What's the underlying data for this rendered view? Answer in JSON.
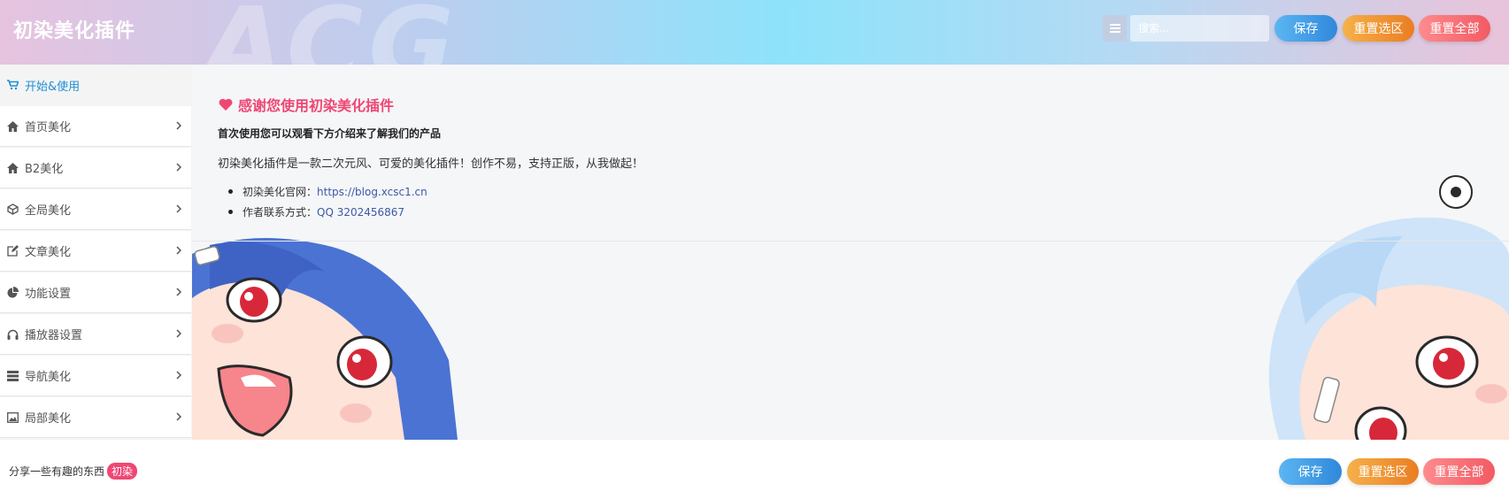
{
  "header": {
    "title": "初染美化插件",
    "search_placeholder": "搜索...",
    "buttons": {
      "save": "保存",
      "reset_section": "重置选区",
      "reset_all": "重置全部"
    }
  },
  "sidebar": {
    "items": [
      {
        "label": "开始&使用",
        "icon": "cart-icon",
        "active": true
      },
      {
        "label": "首页美化",
        "icon": "home-icon"
      },
      {
        "label": "B2美化",
        "icon": "home-icon"
      },
      {
        "label": "全局美化",
        "icon": "cube-icon"
      },
      {
        "label": "文章美化",
        "icon": "edit-icon"
      },
      {
        "label": "功能设置",
        "icon": "pie-chart-icon"
      },
      {
        "label": "播放器设置",
        "icon": "headphones-icon"
      },
      {
        "label": "导航美化",
        "icon": "server-icon"
      },
      {
        "label": "局部美化",
        "icon": "picture-icon"
      }
    ]
  },
  "main": {
    "welcome_title": "感谢您使用初染美化插件",
    "intro": "首次使用您可以观看下方介绍来了解我们的产品",
    "description": "初染美化插件是一款二次元风、可爱的美化插件！创作不易，支持正版，从我做起！",
    "links": [
      {
        "prefix": "初染美化官网：",
        "value": "https://blog.xcsc1.cn"
      },
      {
        "prefix": "作者联系方式：",
        "value": "QQ 3202456867"
      }
    ]
  },
  "footer": {
    "text": "分享一些有趣的东西",
    "badge": "初染",
    "buttons": {
      "save": "保存",
      "reset_section": "重置选区",
      "reset_all": "重置全部"
    }
  },
  "colors": {
    "accent_pink": "#ef4774",
    "link_blue": "#3b59a7",
    "active_blue": "#1e8fd5",
    "btn_blue": "#2f88db",
    "btn_orange": "#eb7d22",
    "btn_red": "#f35a63"
  }
}
